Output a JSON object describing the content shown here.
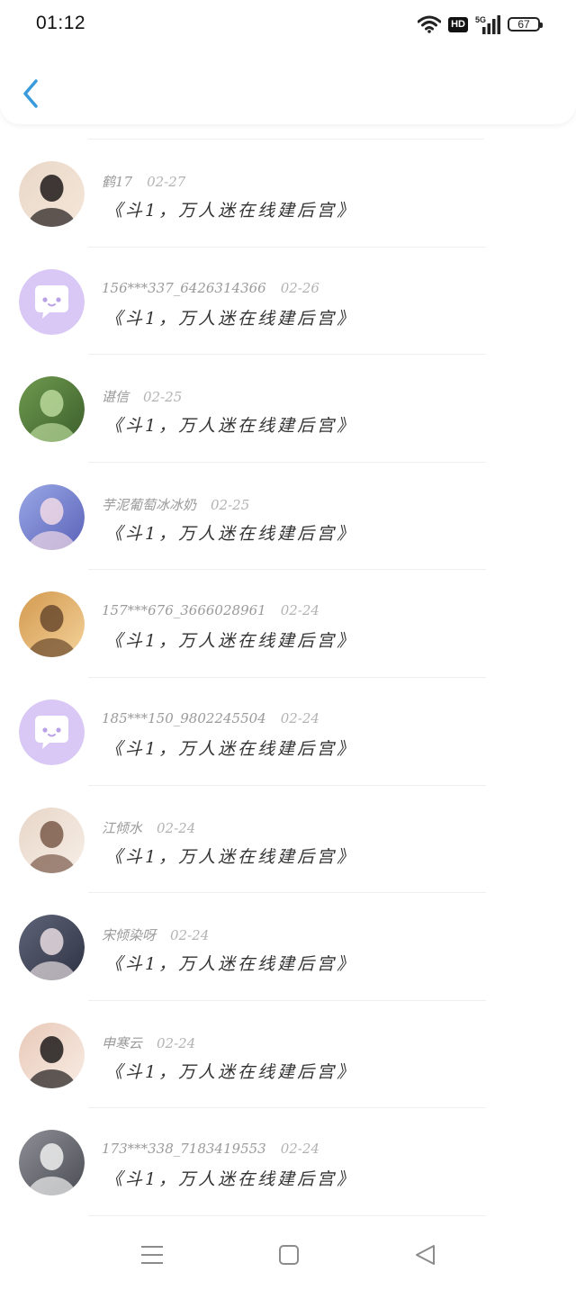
{
  "status_bar": {
    "time": "01:12",
    "hd": "HD",
    "network": "5G",
    "battery": "67"
  },
  "header": {
    "back_icon": "chevron-left-icon"
  },
  "rows": [
    {
      "name": "鹤17",
      "date": "02-27",
      "title": "《斗1，万人迷在线建后宫》",
      "avatar": {
        "type": "photo",
        "colors": [
          "#e9d8c8",
          "#1f1a1a",
          "#f4e6d9"
        ]
      }
    },
    {
      "name": "156***337_6426314366",
      "date": "02-26",
      "title": "《斗1，万人迷在线建后宫》",
      "avatar": {
        "type": "default",
        "colors": [
          "#d9c8f5",
          "#ffffff",
          "#b9a1e8"
        ]
      }
    },
    {
      "name": "谌信",
      "date": "02-25",
      "title": "《斗1，万人迷在线建后宫》",
      "avatar": {
        "type": "photo",
        "colors": [
          "#6f9a4f",
          "#b9d89a",
          "#3c5f2c"
        ]
      }
    },
    {
      "name": "芋泥葡萄冰冰奶",
      "date": "02-25",
      "title": "《斗1，万人迷在线建后宫》",
      "avatar": {
        "type": "photo",
        "colors": [
          "#9aa8e6",
          "#f1d9e6",
          "#5a62b8"
        ]
      }
    },
    {
      "name": "157***676_3666028961",
      "date": "02-24",
      "title": "《斗1，万人迷在线建后宫》",
      "avatar": {
        "type": "photo",
        "colors": [
          "#d39a4e",
          "#6b4a2e",
          "#f3d19a"
        ]
      }
    },
    {
      "name": "185***150_9802245504",
      "date": "02-24",
      "title": "《斗1，万人迷在线建后宫》",
      "avatar": {
        "type": "default",
        "colors": [
          "#d9c8f5",
          "#ffffff",
          "#b9a1e8"
        ]
      }
    },
    {
      "name": "江倾水",
      "date": "02-24",
      "title": "《斗1，万人迷在线建后宫》",
      "avatar": {
        "type": "photo",
        "colors": [
          "#e8d6c8",
          "#7a5a4a",
          "#f6eee6"
        ]
      }
    },
    {
      "name": "宋倾染呀",
      "date": "02-24",
      "title": "《斗1，万人迷在线建后宫》",
      "avatar": {
        "type": "photo",
        "colors": [
          "#5e6478",
          "#e6dbe0",
          "#2f3344"
        ]
      }
    },
    {
      "name": "申寒云",
      "date": "02-24",
      "title": "《斗1，万人迷在线建后宫》",
      "avatar": {
        "type": "photo",
        "colors": [
          "#e8c9b8",
          "#1e1b1b",
          "#f8ece4"
        ]
      }
    },
    {
      "name": "173***338_7183419553",
      "date": "02-24",
      "title": "《斗1，万人迷在线建后宫》",
      "avatar": {
        "type": "photo",
        "colors": [
          "#8e8f96",
          "#efefef",
          "#4b4d55"
        ]
      }
    }
  ],
  "nav": {
    "menu_icon": "menu-icon",
    "home_icon": "home-square-icon",
    "back_icon": "back-triangle-icon"
  }
}
